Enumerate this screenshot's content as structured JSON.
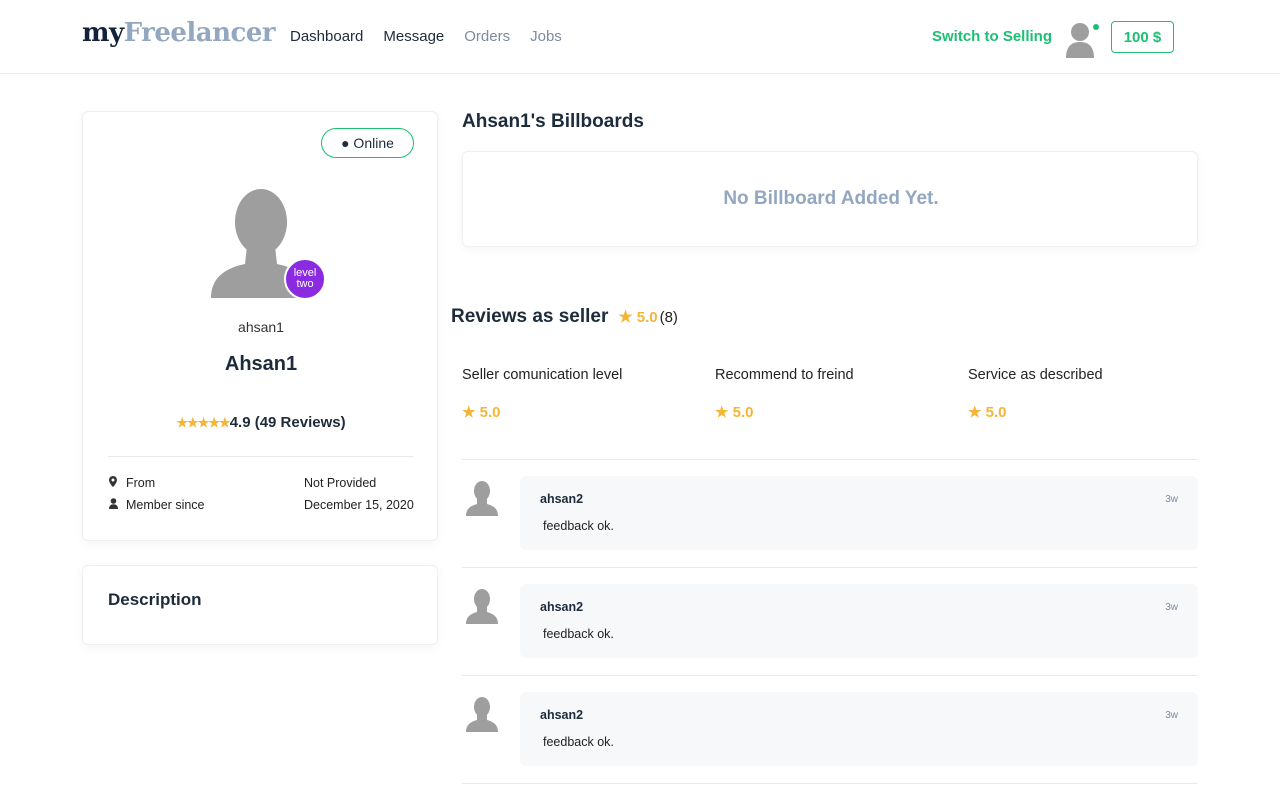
{
  "header": {
    "logo_part1": "my",
    "logo_part2": "Freelancer",
    "nav": [
      "Dashboard",
      "Message",
      "Orders",
      "Jobs"
    ],
    "switch_label": "Switch to Selling",
    "balance": "100 $"
  },
  "profile": {
    "status": "● Online",
    "level_badge_line1": "level",
    "level_badge_line2": "two",
    "username_small": "ahsan1",
    "username_big": "Ahsan1",
    "stars": "★★★★★",
    "rating_text": "4.9 (49 Reviews)",
    "rating_value": 4.9,
    "from_label": "From",
    "from_value": "Not Provided",
    "member_label": "Member since",
    "member_value": "December 15, 2020"
  },
  "description": {
    "title": "Description"
  },
  "billboards": {
    "title": "Ahsan1's Billboards",
    "empty_text": "No Billboard Added Yet."
  },
  "reviews": {
    "title": "Reviews as seller",
    "star": "★",
    "score": "5.0",
    "count": "(8)",
    "criteria": [
      {
        "label": "Seller comunication level",
        "value": "5.0"
      },
      {
        "label": "Recommend to freind",
        "value": "5.0"
      },
      {
        "label": "Service as described",
        "value": "5.0"
      }
    ],
    "items": [
      {
        "name": "ahsan2",
        "time": "3w",
        "message": "feedback ok."
      },
      {
        "name": "ahsan2",
        "time": "3w",
        "message": "feedback ok."
      },
      {
        "name": "ahsan2",
        "time": "3w",
        "message": "feedback ok."
      }
    ]
  },
  "colors": {
    "accent": "#1dbf73",
    "star": "#f5b638",
    "level_badge": "#8a2be2",
    "muted": "#93a7c0"
  },
  "icons": {
    "from": "map-marker-icon",
    "member": "user-icon",
    "avatar": "default-avatar-icon"
  }
}
